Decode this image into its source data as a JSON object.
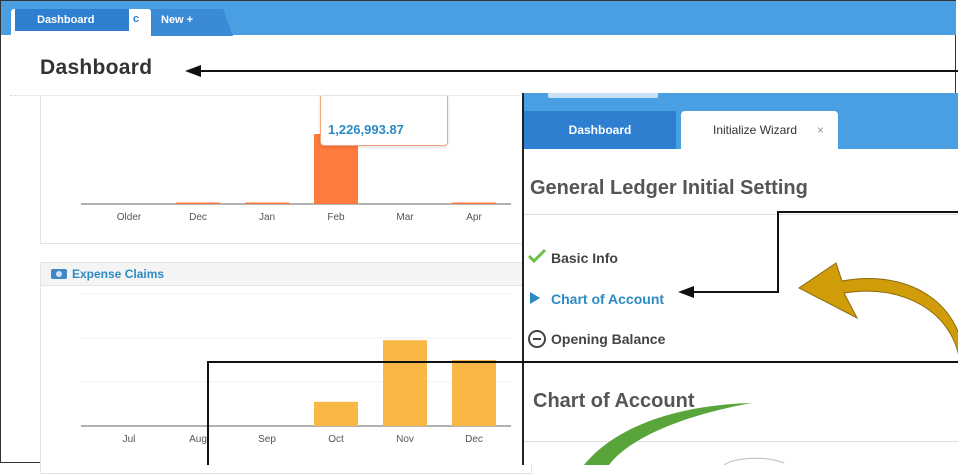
{
  "tabs": {
    "active_label": "Dashboard",
    "refresh_glyph": "c",
    "new_label": "New +"
  },
  "page_title": "Dashboard",
  "revenue_chart": {
    "tooltip_value": "1,226,993.87"
  },
  "expense_panel": {
    "title": "Expense Claims",
    "icon": "money-icon"
  },
  "overlay": {
    "tab_dashboard": "Dashboard",
    "tab_wizard": "Initialize Wizard",
    "close_glyph": "×",
    "heading": "General Ledger Initial Setting",
    "steps": [
      {
        "label": "Basic Info",
        "status": "done"
      },
      {
        "label": "Chart of Account",
        "status": "current"
      },
      {
        "label": "Opening Balance",
        "status": "pending"
      }
    ],
    "section_heading": "Chart of Account"
  },
  "colors": {
    "tab_blue": "#4a9fe2",
    "accent_blue": "#2c8ac4",
    "bar_orange": "#ff7a3d",
    "bar_yellow": "#f9b846",
    "arrow_gold": "#d19c09",
    "arrow_green": "#5aa53a"
  },
  "chart_data": [
    {
      "type": "bar",
      "categories": [
        "Older",
        "Dec",
        "Jan",
        "Feb",
        "Mar",
        "Apr"
      ],
      "values": [
        0,
        15000,
        10000,
        1226993.87,
        0,
        5000
      ],
      "title": "",
      "annotations": [
        "1,226,993.87"
      ]
    },
    {
      "type": "bar",
      "title": "Expense Claims",
      "categories": [
        "Jul",
        "Aug",
        "Sep",
        "Oct",
        "Nov",
        "Dec"
      ],
      "values": [
        0,
        0,
        0,
        22,
        78,
        60
      ]
    }
  ]
}
